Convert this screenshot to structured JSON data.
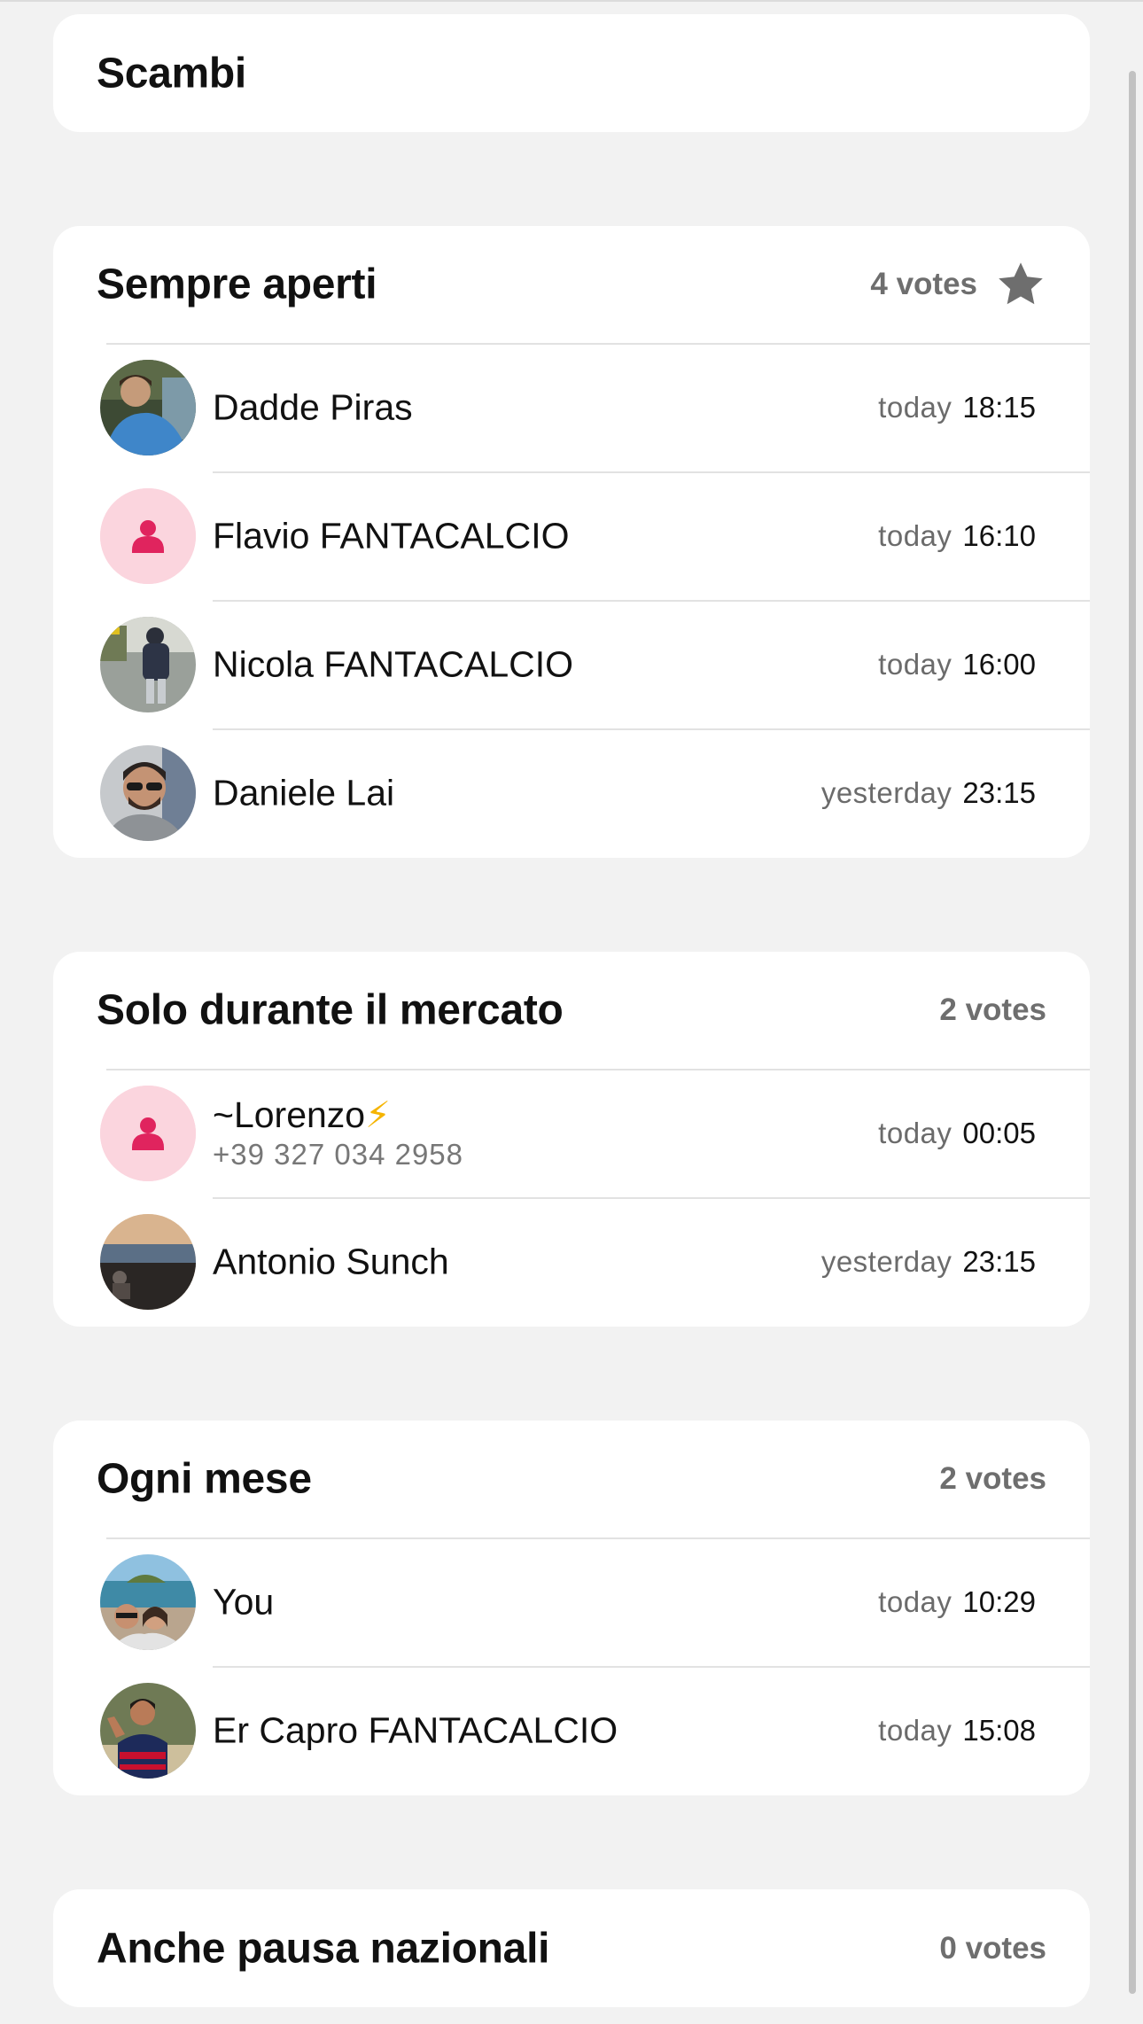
{
  "header": {
    "title": "Scambi"
  },
  "options": [
    {
      "title": "Sempre aperti",
      "votes": "4 votes",
      "voters": [
        {
          "name": "Dadde Piras",
          "day": "today",
          "time": "18:15",
          "avatar": "photo-avatar"
        },
        {
          "name": "Flavio FANTACALCIO",
          "day": "today",
          "time": "16:10",
          "avatar": "default-avatar"
        },
        {
          "name": "Nicola FANTACALCIO",
          "day": "today",
          "time": "16:00",
          "avatar": "photo-avatar"
        },
        {
          "name": "Daniele Lai",
          "day": "yesterday",
          "time": "23:15",
          "avatar": "photo-avatar"
        }
      ]
    },
    {
      "title": "Solo durante il mercato",
      "votes": "2 votes",
      "voters": [
        {
          "name": "~Lorenzo",
          "emoji": "⚡",
          "phone": "+39 327 034 2958",
          "day": "today",
          "time": "00:05",
          "avatar": "default-avatar"
        },
        {
          "name": "Antonio Sunch",
          "day": "yesterday",
          "time": "23:15",
          "avatar": "photo-avatar"
        }
      ]
    },
    {
      "title": "Ogni mese",
      "votes": "2 votes",
      "voters": [
        {
          "name": "You",
          "day": "today",
          "time": "10:29",
          "avatar": "photo-avatar"
        },
        {
          "name": "Er Capro FANTACALCIO",
          "day": "today",
          "time": "15:08",
          "avatar": "photo-avatar"
        }
      ]
    },
    {
      "title": "Anche pausa nazionali",
      "votes": "0 votes",
      "voters": []
    }
  ],
  "colors": {
    "background": "#f2f2f2",
    "card": "#ffffff",
    "default_avatar_bg": "#fbd5de",
    "default_avatar_icon": "#e0245e",
    "star": "#6e6e6e"
  }
}
